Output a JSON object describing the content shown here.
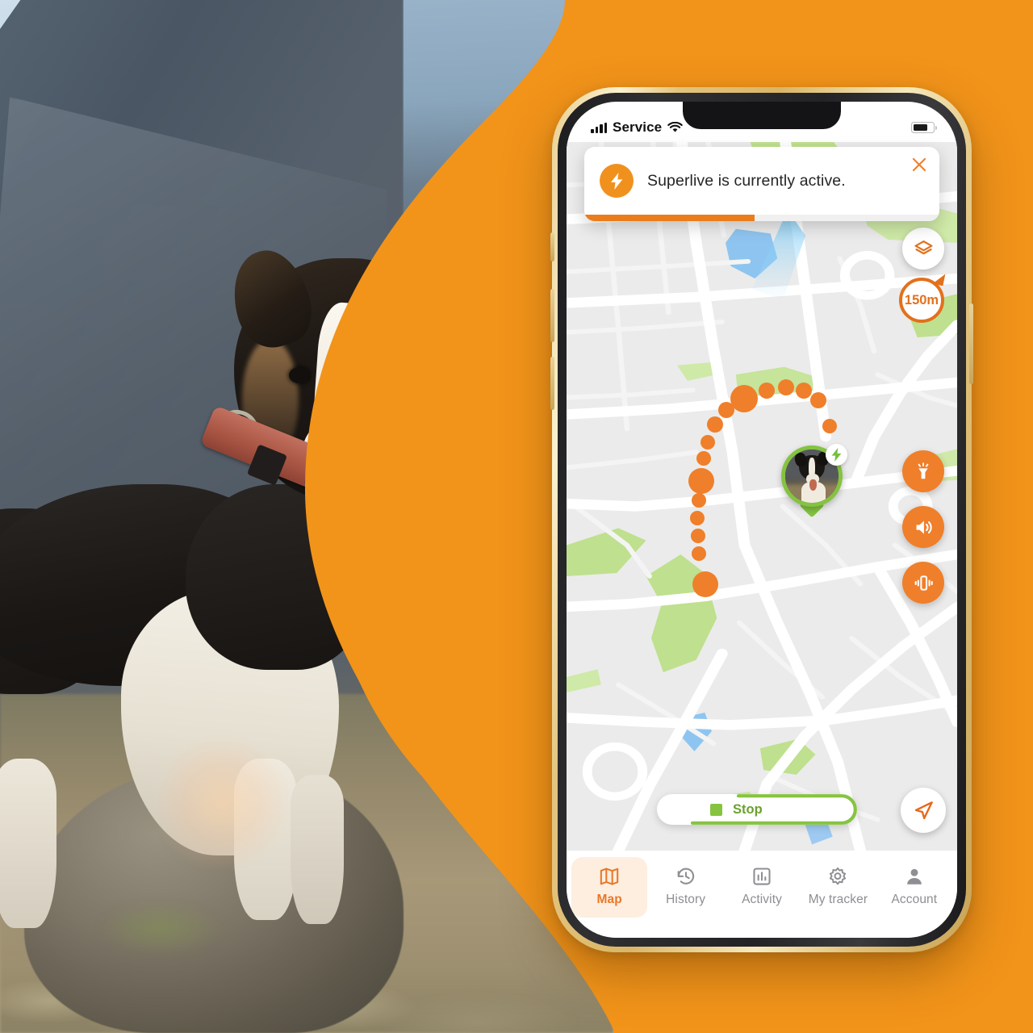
{
  "background": {
    "brand_orange": "#f2941a",
    "accent_orange": "#ef7f2a",
    "accent_green": "#86c440"
  },
  "photo": {
    "alt": "border-collie-dog-wearing-gps-tracker-collar-on-rock"
  },
  "phone": {
    "status_bar": {
      "carrier": "Service",
      "signal_icon": "signal-bars-icon",
      "wifi_icon": "wifi-icon",
      "battery_icon": "battery-icon"
    },
    "notification": {
      "icon": "lightning-bolt-icon",
      "message": "Superlive is currently active.",
      "close_icon": "close-icon",
      "progress_percent": 48
    },
    "map": {
      "layers_button": {
        "icon": "layers-icon",
        "label": "Layers"
      },
      "radius_badge": {
        "value": "150m",
        "icon": "radius-arrow-icon"
      },
      "user_location": {
        "icon": "user-location-dot",
        "color": "#1a85d6"
      },
      "pet_marker": {
        "name": "pet-avatar-marker",
        "ring_color": "#84c341",
        "badge_icon": "lightning-bolt-icon"
      },
      "trail": {
        "name": "pet-trail-dots",
        "color": "#ef7f2a"
      },
      "actions": [
        {
          "name": "light-button",
          "icon": "flashlight-icon"
        },
        {
          "name": "sound-button",
          "icon": "speaker-icon"
        },
        {
          "name": "vibrate-button",
          "icon": "vibrate-icon"
        }
      ],
      "stop_button": {
        "label": "Stop",
        "icon": "stop-square-icon",
        "progress_percent": 72
      },
      "compass_button": {
        "icon": "navigate-arrow-icon"
      }
    },
    "tabbar": {
      "items": [
        {
          "label": "Map",
          "icon": "map-icon",
          "active": true
        },
        {
          "label": "History",
          "icon": "history-clock-icon",
          "active": false
        },
        {
          "label": "Activity",
          "icon": "bar-chart-icon",
          "active": false
        },
        {
          "label": "My tracker",
          "icon": "gear-icon",
          "active": false
        },
        {
          "label": "Account",
          "icon": "person-icon",
          "active": false
        }
      ]
    }
  }
}
